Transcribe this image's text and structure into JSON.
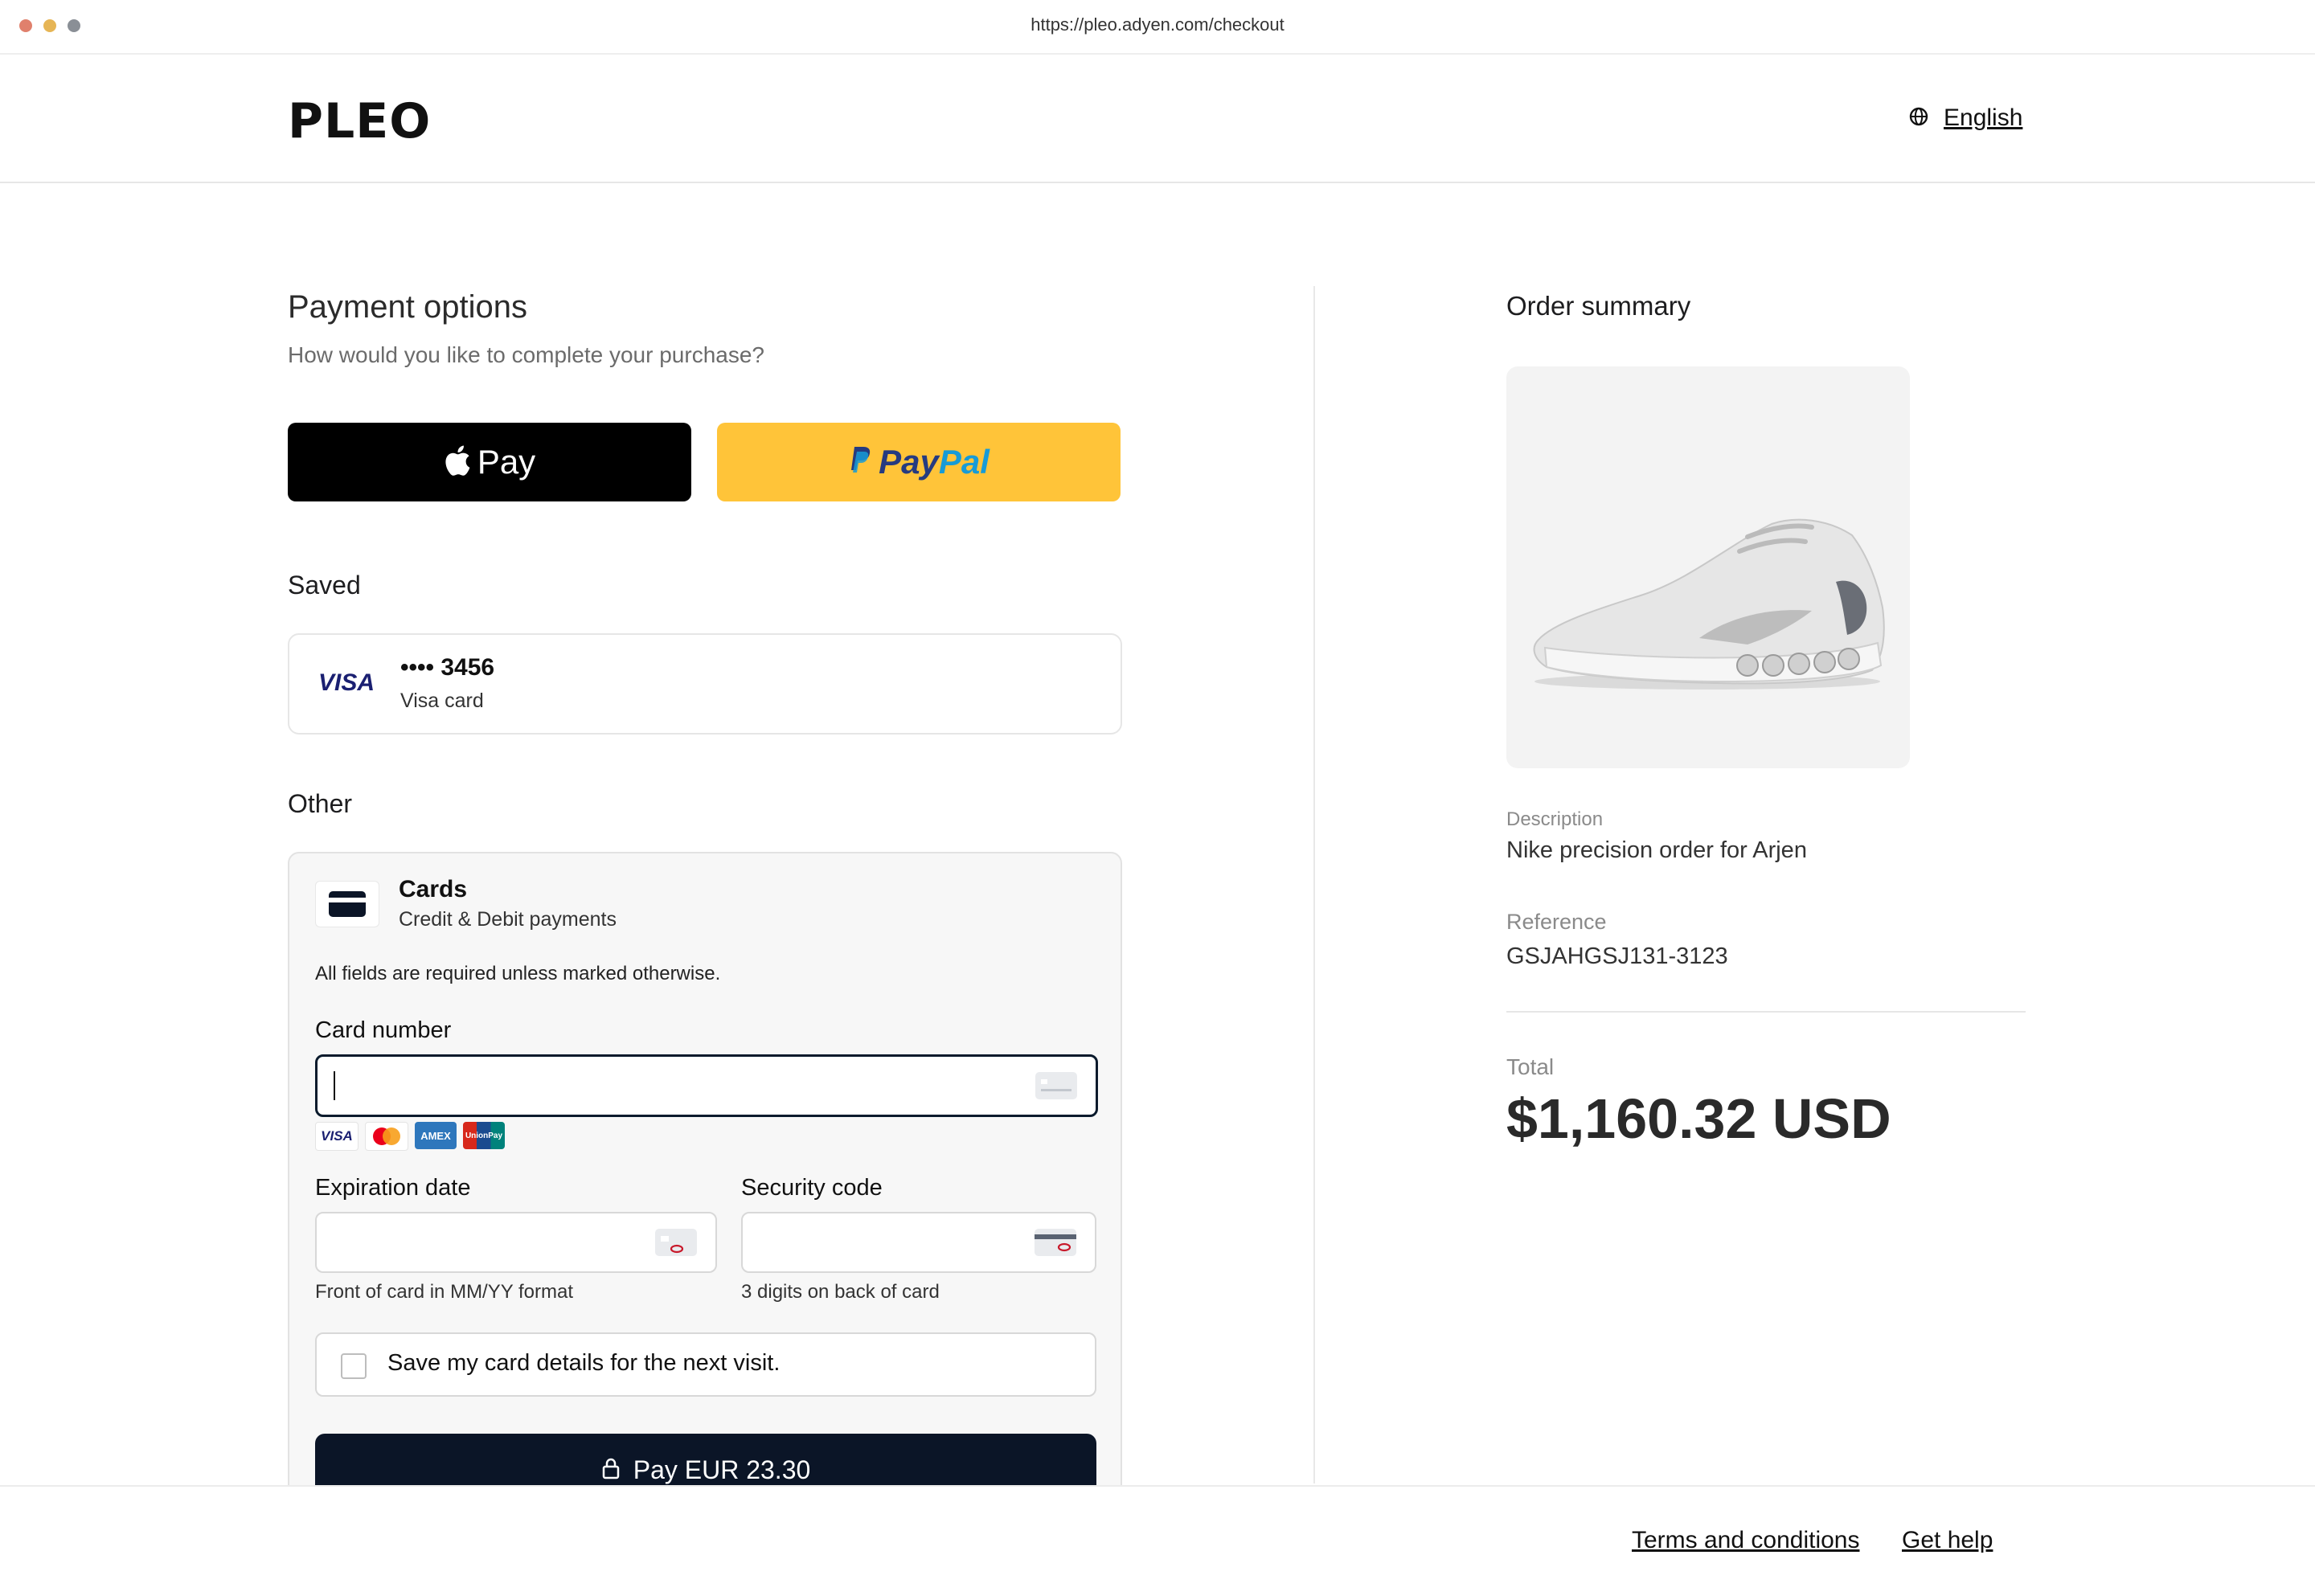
{
  "browser": {
    "url": "https://pleo.adyen.com/checkout"
  },
  "header": {
    "logo": "PLEO",
    "language": "English",
    "language_icon": "globe-icon"
  },
  "payment": {
    "title": "Payment options",
    "subtitle": "How would you like to complete your purchase?",
    "apple_pay_label": "Pay",
    "paypal_pay": "Pay",
    "paypal_pal": "Pal",
    "saved_heading": "Saved",
    "saved_card": {
      "brand": "VISA",
      "number": "•••• 3456",
      "type": "Visa card"
    },
    "other_heading": "Other",
    "cards": {
      "title": "Cards",
      "subtitle": "Credit & Debit payments",
      "required_note": "All fields are required unless marked otherwise.",
      "card_number_label": "Card number",
      "card_number_value": "",
      "brands": [
        "VISA",
        "Mastercard",
        "AMEX",
        "UnionPay"
      ],
      "expiry_label": "Expiration date",
      "expiry_hint": "Front of card in MM/YY format",
      "cvc_label": "Security code",
      "cvc_hint": "3 digits on back of card",
      "save_label": "Save my card details for the next visit.",
      "pay_button": "Pay EUR 23.30"
    }
  },
  "order": {
    "title": "Order summary",
    "description_label": "Description",
    "description": "Nike precision order for Arjen",
    "reference_label": "Reference",
    "reference": "GSJAHGSJ131-3123",
    "total_label": "Total",
    "total": "$1,160.32 USD"
  },
  "footer": {
    "terms": "Terms and conditions",
    "help": "Get help"
  },
  "colors": {
    "pay_button": "#0b1527",
    "paypal": "#ffc439",
    "apple": "#000000"
  }
}
